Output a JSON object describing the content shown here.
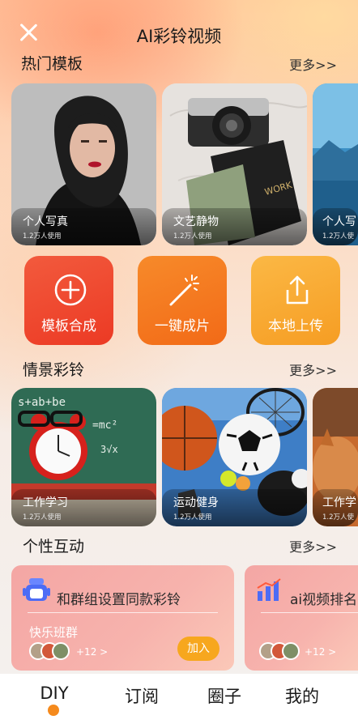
{
  "header": {
    "title": "AI彩铃视频",
    "close_icon": "close-icon"
  },
  "sections": {
    "hot": {
      "title": "热门模板",
      "more": "更多>>"
    },
    "scene": {
      "title": "情景彩铃",
      "more": "更多>>"
    },
    "interact": {
      "title": "个性互动",
      "more": "更多>>"
    }
  },
  "hot_cards": [
    {
      "title": "个人写真",
      "usage": "1.2万人使用"
    },
    {
      "title": "文艺静物",
      "usage": "1.2万人使用"
    },
    {
      "title": "个人写",
      "usage": "1.2万人使"
    }
  ],
  "actions": [
    {
      "label": "模板合成",
      "icon": "plus-circle-icon",
      "color": "#f0432e"
    },
    {
      "label": "一键成片",
      "icon": "magic-wand-icon",
      "color": "#f5761c"
    },
    {
      "label": "本地上传",
      "icon": "upload-icon",
      "color": "#f8a62e"
    }
  ],
  "scene_cards": [
    {
      "title": "工作学习",
      "usage": "1.2万人使用"
    },
    {
      "title": "运动健身",
      "usage": "1.2万人使用"
    },
    {
      "title": "工作学",
      "usage": "1.2万人使"
    }
  ],
  "interact_cards": [
    {
      "headline": "和群组设置同款彩铃",
      "group": "快乐班群",
      "count": "+12 >",
      "join": "加入",
      "icon": "robot-icon"
    },
    {
      "headline": "ai视频排名",
      "count": "+12 >",
      "icon": "bar-chart-icon"
    }
  ],
  "tabs": [
    "DIY",
    "订阅",
    "圈子",
    "我的"
  ],
  "active_tab": "DIY",
  "colors": {
    "accent": "#f58a1d",
    "join": "#f7a71e"
  }
}
